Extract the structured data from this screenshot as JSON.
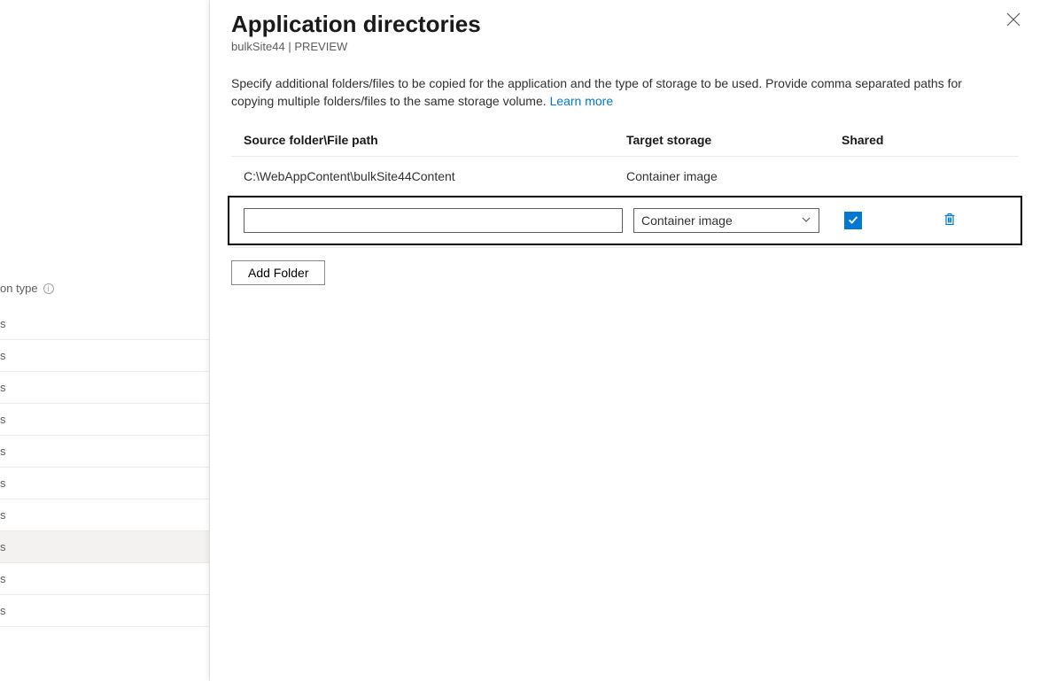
{
  "underlay": {
    "type_label": "on type",
    "rows": [
      "s",
      "s",
      "s",
      "s",
      "s",
      "s",
      "s",
      "s",
      "s",
      "s"
    ],
    "selected_index": 7
  },
  "blade": {
    "title": "Application directories",
    "subtitle_site": "bulkSite44",
    "subtitle_sep": " | ",
    "subtitle_preview": "PREVIEW",
    "description": "Specify additional folders/files to be copied for the application and the type of storage to be used. Provide comma separated paths for copying multiple folders/files to the same storage volume. ",
    "learn_more": "Learn more",
    "columns": {
      "source": "Source folder\\File path",
      "target": "Target storage",
      "shared": "Shared"
    },
    "existing_row": {
      "source": "C:\\WebAppContent\\bulkSite44Content",
      "target": "Container image"
    },
    "edit_row": {
      "source_value": "",
      "target_selected": "Container image",
      "shared_checked": true
    },
    "add_folder_label": "Add Folder"
  }
}
